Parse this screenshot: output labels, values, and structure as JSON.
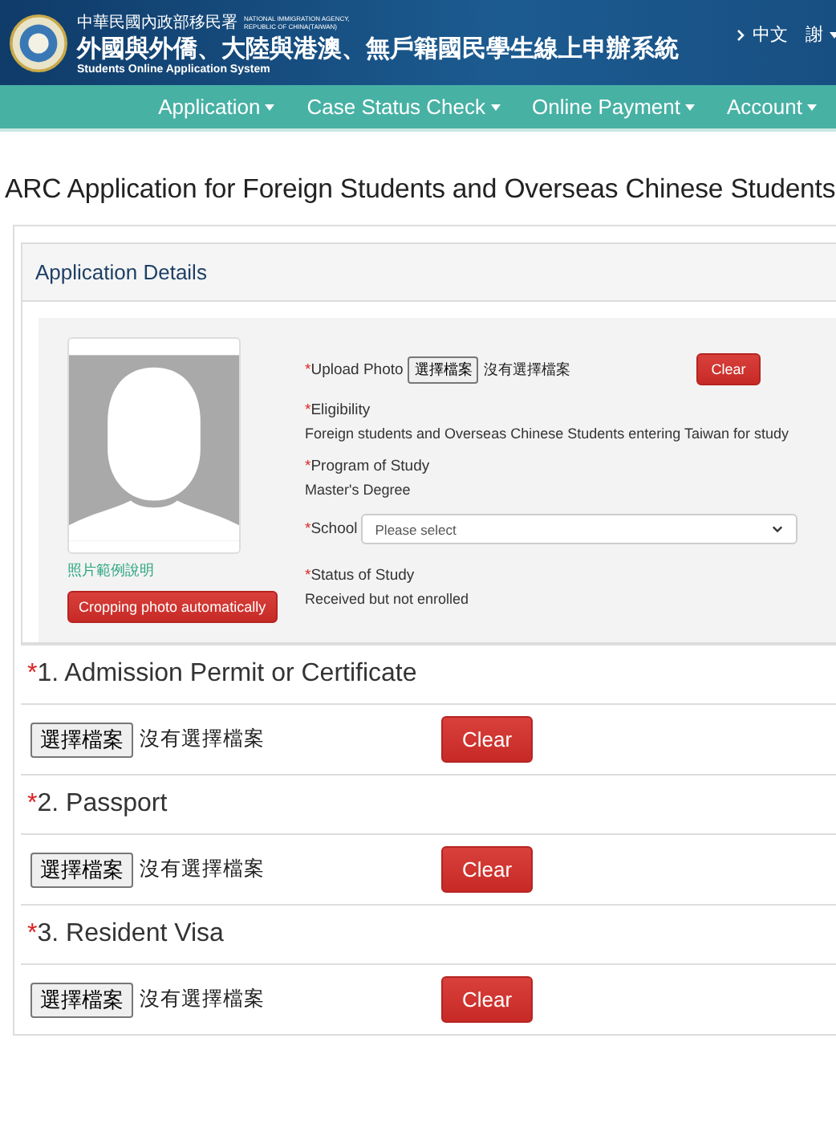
{
  "header": {
    "agency_zh": "中華民國內政部移民署",
    "agency_en": [
      "NATIONAL IMMIGRATION AGENCY,",
      "REPUBLIC OF CHINA(TAIWAN)"
    ],
    "system_title": "外國與外僑、大陸與港澳、無戶籍國民學生線上申辦系統",
    "system_subtitle": "Students Online Application System",
    "language": "中文",
    "user": "謝"
  },
  "nav": [
    {
      "label": "Application"
    },
    {
      "label": "Case Status Check"
    },
    {
      "label": "Online Payment"
    },
    {
      "label": "Account"
    }
  ],
  "page_title": "ARC Application for Foreign Students and Overseas Chinese Students",
  "details": {
    "heading": "Application Details",
    "photo_guide_link": "照片範例說明",
    "crop_button": "Cropping photo automatically",
    "upload": {
      "label": "Upload Photo",
      "required": "*",
      "file_button": "選擇檔案",
      "file_status": "沒有選擇檔案",
      "clear_button": "Clear"
    },
    "fields": [
      {
        "kind": "text",
        "required": "*",
        "label": "Eligibility",
        "value": "Foreign students and Overseas Chinese Students entering Taiwan for study"
      },
      {
        "kind": "text",
        "required": "*",
        "label": "Program of Study",
        "value": "Master's Degree"
      },
      {
        "kind": "select",
        "required": "*",
        "label": "School",
        "placeholder": "Please select"
      },
      {
        "kind": "text",
        "required": "*",
        "label": "Status of Study",
        "value": "Received but not enrolled"
      }
    ]
  },
  "documents": [
    {
      "required": "*",
      "title": "1. Admission Permit or Certificate",
      "file_button": "選擇檔案",
      "file_status": "沒有選擇檔案",
      "clear_button": "Clear"
    },
    {
      "required": "*",
      "title": "2. Passport",
      "file_button": "選擇檔案",
      "file_status": "沒有選擇檔案",
      "clear_button": "Clear"
    },
    {
      "required": "*",
      "title": "3. Resident Visa",
      "file_button": "選擇檔案",
      "file_status": "沒有選擇檔案",
      "clear_button": "Clear"
    }
  ]
}
